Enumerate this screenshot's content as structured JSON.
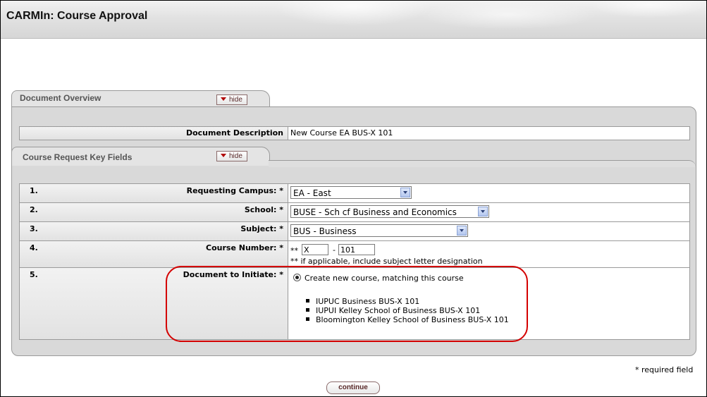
{
  "app": {
    "title": "CARMIn: Course Approval"
  },
  "document_overview": {
    "title": "Document Overview",
    "hide_label": "hide",
    "description_label": "Document Description",
    "description_value": "New Course EA BUS-X 101"
  },
  "key_fields": {
    "title": "Course Request Key Fields",
    "hide_label": "hide",
    "rows": [
      {
        "num": "1.",
        "label": "Requesting Campus: *",
        "value": "EA - East"
      },
      {
        "num": "2.",
        "label": "School: *",
        "value": "BUSE - Sch cf Business and Economics"
      },
      {
        "num": "3.",
        "label": "Subject: *",
        "value": "BUS - Business"
      },
      {
        "num": "4.",
        "label": "Course Number: *",
        "prefix": "**",
        "letter_value": "X",
        "dash": "-",
        "number_value": "101",
        "hint": "** if applicable, include subject letter designation"
      },
      {
        "num": "5.",
        "label": "Document to Initiate: *",
        "radio_label": "Create new course, matching this course",
        "matches": [
          "IUPUC Business BUS-X 101",
          "IUPUI Kelley School of Business BUS-X 101",
          "Bloomington Kelley School of Business BUS-X 101"
        ]
      }
    ]
  },
  "footer": {
    "required_note": "* required field",
    "continue_label": "continue"
  },
  "colors": {
    "highlight": "#d40000",
    "button_text": "#5a2a2a"
  }
}
